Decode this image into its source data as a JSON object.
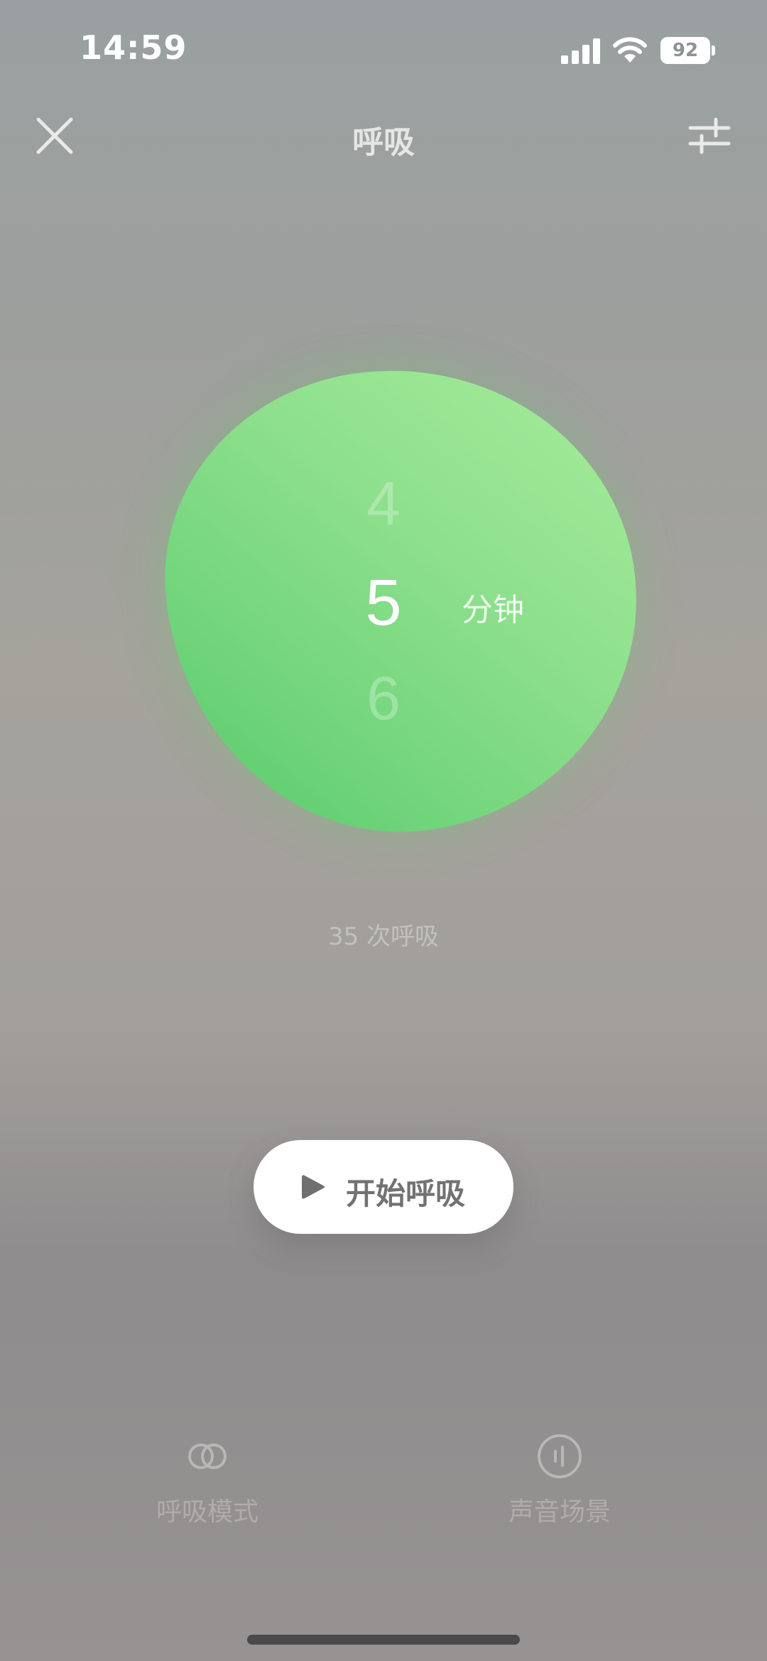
{
  "status_bar": {
    "time": "14:59",
    "battery_level": "92",
    "icons": [
      "cellular-signal-icon",
      "wifi-icon",
      "battery-icon"
    ]
  },
  "nav": {
    "title": "呼吸",
    "close_icon": "close-icon",
    "settings_icon": "sliders-icon"
  },
  "duration_picker": {
    "prev_value": "4",
    "selected_value": "5",
    "next_value": "6",
    "unit": "分钟"
  },
  "breath_count_text": "35 次呼吸",
  "start_button": {
    "label": "开始呼吸",
    "icon": "play-icon"
  },
  "bottom_tabs": [
    {
      "label": "呼吸模式",
      "icon": "linked-rings-icon"
    },
    {
      "label": "声音场景",
      "icon": "sound-scene-icon"
    }
  ],
  "colors": {
    "blob_light": "#a7ec9a",
    "blob_dark": "#55c86a",
    "button_bg": "#ffffff"
  }
}
